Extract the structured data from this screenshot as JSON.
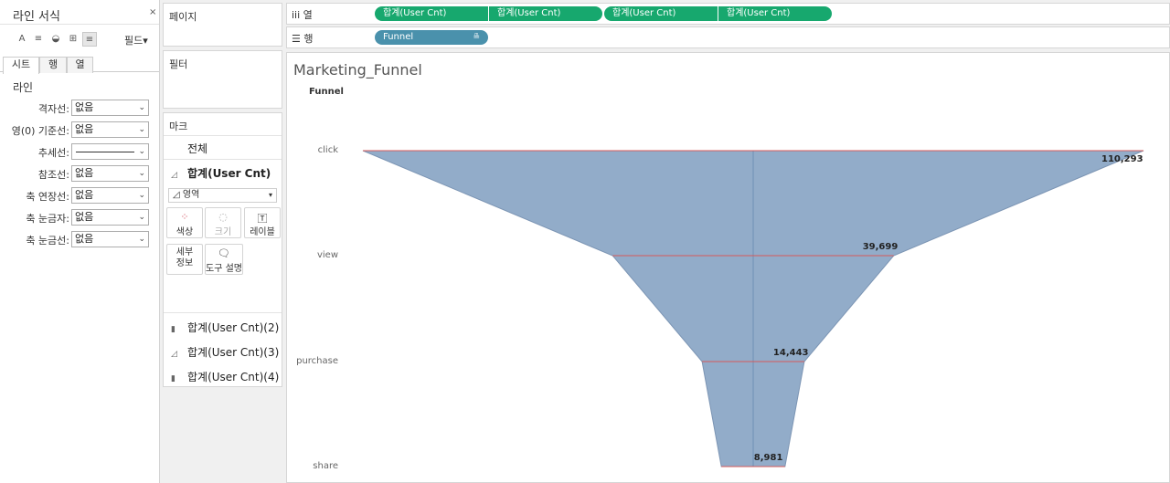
{
  "format_pane": {
    "title": "라인 서식",
    "close": "×",
    "fields_label": "필드▾",
    "tools": [
      "A",
      "≡",
      "◒",
      "⊞",
      "≡"
    ],
    "tabs": [
      "시트",
      "행",
      "열"
    ],
    "section": "라인",
    "rows": [
      {
        "label": "격자선:",
        "value": "없음"
      },
      {
        "label": "영(0) 기준선:",
        "value": "없음"
      },
      {
        "label": "추세선:",
        "value": ""
      },
      {
        "label": "참조선:",
        "value": "없음"
      },
      {
        "label": "축 연장선:",
        "value": "없음"
      },
      {
        "label": "축 눈금자:",
        "value": "없음"
      },
      {
        "label": "축 눈금선:",
        "value": "없음"
      }
    ]
  },
  "pages_title": "페이지",
  "filters_title": "필터",
  "marks": {
    "title": "마크",
    "all": "전체",
    "active_field": "합계(User Cnt)",
    "mark_type": "영역",
    "buttons": {
      "color": "색상",
      "size": "크기",
      "label": "레이블",
      "detail": "세부\n정보",
      "tooltip": "도구 설명"
    },
    "other_fields": [
      "합계(User Cnt)(2)",
      "합계(User Cnt)(3)",
      "합계(User Cnt)(4)"
    ]
  },
  "columns_shelf": {
    "label": "iii 열",
    "pills": [
      "합계(User Cnt)",
      "합계(User Cnt)",
      "합계(User Cnt)",
      "합계(User Cnt)"
    ]
  },
  "rows_shelf": {
    "label": "☰ 행",
    "pill": "Funnel"
  },
  "chart_data": {
    "type": "area",
    "title": "Marketing_Funnel",
    "row_header": "Funnel",
    "categories": [
      "click",
      "view",
      "purchase",
      "share"
    ],
    "values": [
      110293,
      39699,
      14443,
      8981
    ],
    "value_labels": [
      "110,293",
      "39,699",
      "14,443",
      "8,981"
    ],
    "orientation": "mirrored funnel",
    "colors": {
      "fill": "#92acc9",
      "edge": "#7c95b4",
      "divider": "#d65a5a",
      "axis": "#6d8fb5"
    }
  }
}
